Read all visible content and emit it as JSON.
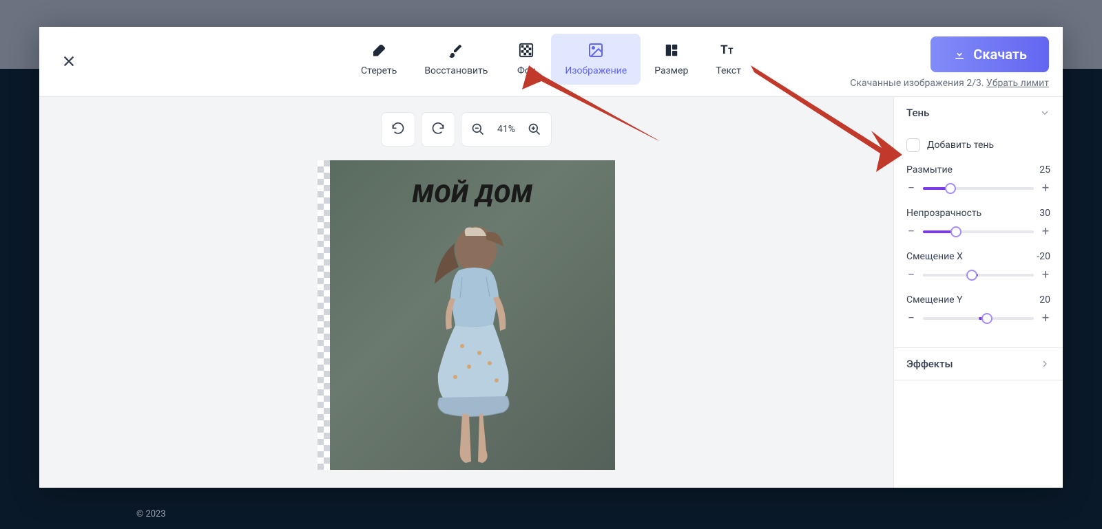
{
  "toolbar": {
    "tools": [
      {
        "label": "Стереть"
      },
      {
        "label": "Восстановить"
      },
      {
        "label": "Фон"
      },
      {
        "label": "Изображение"
      },
      {
        "label": "Размер"
      },
      {
        "label": "Текст"
      }
    ],
    "download_label": "Скачать",
    "download_info_prefix": "Скачанные изображения 2/3. ",
    "download_info_link": "Убрать лимит"
  },
  "canvas": {
    "zoom": "41%",
    "image_text": "МОЙ  ДОМ"
  },
  "panel": {
    "shadow": {
      "title": "Тень",
      "add_shadow_label": "Добавить тень",
      "sliders": [
        {
          "label": "Размытие",
          "value": "25",
          "pct": 25
        },
        {
          "label": "Непрозрачность",
          "value": "30",
          "pct": 30
        },
        {
          "label": "Смещение X",
          "value": "-20",
          "pct": 44
        },
        {
          "label": "Смещение Y",
          "value": "20",
          "pct": 58
        }
      ]
    },
    "effects": {
      "title": "Эффекты"
    }
  },
  "footer": "© 2023"
}
